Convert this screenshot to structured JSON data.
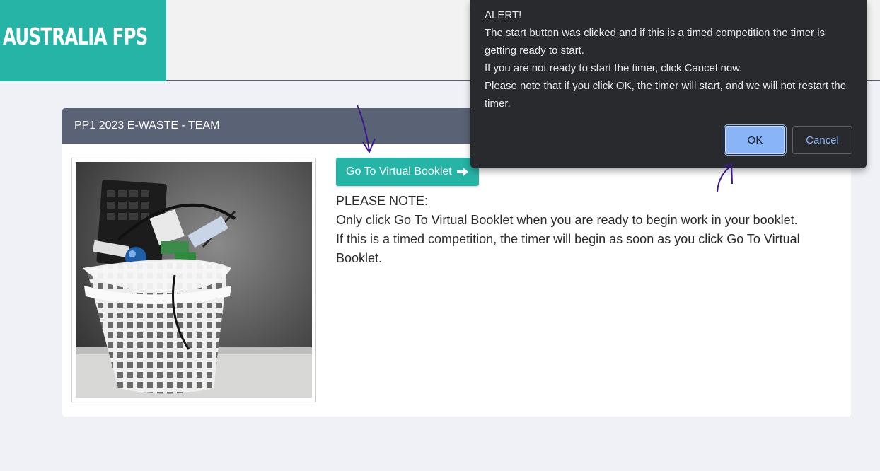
{
  "brand": {
    "title": "AUSTRALIA FPS",
    "color": "#26b4a6"
  },
  "card": {
    "title": "PP1 2023 E-WASTE - TEAM",
    "image_alt": "e-waste-basket",
    "go_button_label": "Go To Virtual Booklet",
    "note_heading": "PLEASE NOTE:",
    "note_line1": "Only click Go To Virtual Booklet when you are ready to begin work in your booklet.",
    "note_line2": "If this is a timed competition, the timer will begin as soon as you click Go To Virtual Booklet."
  },
  "dialog": {
    "line1": "ALERT!",
    "line2": "The start button was clicked and if this is a timed competition the timer is getting ready to start.",
    "line3": "If you are not ready to start the timer, click Cancel now.",
    "line4": "Please note that if you click OK, the timer will start, and we will not restart the timer.",
    "ok_label": "OK",
    "cancel_label": "Cancel"
  },
  "icons": {
    "go_button_icon": "arrow-right-icon"
  },
  "colors": {
    "header_bg": "#5a6275",
    "dialog_bg": "#292a2d",
    "ok_bg": "#8ab4f8",
    "annotation": "#3a1a8a"
  }
}
